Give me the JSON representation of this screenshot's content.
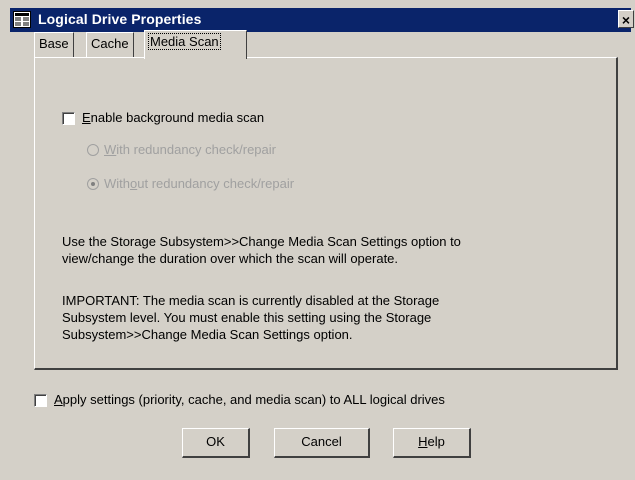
{
  "window": {
    "title": "Logical Drive Properties",
    "close_glyph": "×"
  },
  "tabs": [
    {
      "label": "Base",
      "active": false
    },
    {
      "label": "Cache",
      "active": false
    },
    {
      "label": "Media Scan",
      "active": true
    }
  ],
  "media_scan": {
    "enable_mnemonic": "E",
    "enable_rest": "nable background media scan",
    "enable_checked": false,
    "radio_with_mnemonic": "W",
    "radio_with_rest": "ith redundancy check/repair",
    "radio_without_pre": "With",
    "radio_without_mnemonic": "o",
    "radio_without_rest": "ut redundancy check/repair",
    "selected_option": "without",
    "info_line1": "Use the Storage Subsystem>>Change Media Scan Settings option to",
    "info_line2": "view/change the duration over which the scan will operate.",
    "important_line1": "IMPORTANT: The media scan is currently disabled at the Storage",
    "important_line2": "Subsystem level. You must enable this setting using the Storage",
    "important_line3": "Subsystem>>Change Media Scan Settings option."
  },
  "apply_all": {
    "mnemonic": "A",
    "rest": "pply settings (priority, cache, and media scan) to ALL logical drives",
    "checked": false
  },
  "buttons": {
    "ok": "OK",
    "cancel": "Cancel",
    "help_mnemonic": "H",
    "help_rest": "elp"
  },
  "colors": {
    "titlebar": "#0a246a",
    "face": "#d4d0c8",
    "disabled_text": "#a0a0a0"
  }
}
